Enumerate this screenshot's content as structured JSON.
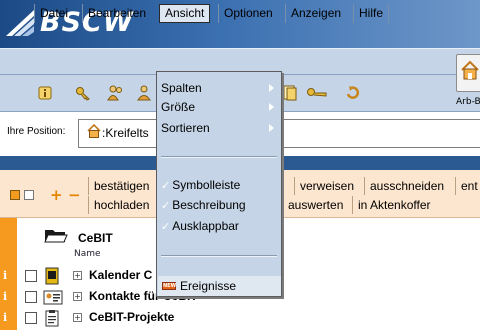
{
  "app": {
    "logo_text": "BSCW"
  },
  "menubar": {
    "items": [
      {
        "label": "Datei"
      },
      {
        "label": "Bearbeiten"
      },
      {
        "label": "Ansicht"
      },
      {
        "label": "Optionen"
      },
      {
        "label": "Anzeigen"
      },
      {
        "label": "Hilfe"
      }
    ]
  },
  "home_button": {
    "label": "Arb-B"
  },
  "position": {
    "label": "Ihre Position:",
    "path": ":Kreifelts"
  },
  "actions": {
    "row1": [
      "bestätigen",
      "verweisen",
      "ausschneiden",
      "ent"
    ],
    "row2": [
      "hochladen",
      "auswerten",
      "in Aktenkoffer"
    ],
    "plus": "+",
    "minus": "−"
  },
  "folder": {
    "title": "CeBIT",
    "name_header": "Name"
  },
  "rows": [
    {
      "name": "Kalender C",
      "info": "i"
    },
    {
      "name": "Kontakte für CeBIT",
      "info": "i"
    },
    {
      "name": "CeBIT-Projekte",
      "info": "i"
    }
  ],
  "dropdown": {
    "submenus": [
      {
        "label": "Spalten"
      },
      {
        "label": "Größe"
      },
      {
        "label": "Sortieren"
      }
    ],
    "toggles": [
      {
        "label": "Symbolleiste",
        "check": "✓"
      },
      {
        "label": "Beschreibung",
        "check": "✓"
      },
      {
        "label": "Ausklappbar",
        "check": "✓"
      }
    ],
    "events": {
      "label": "Ereignisse",
      "badge": "NEW"
    }
  }
}
